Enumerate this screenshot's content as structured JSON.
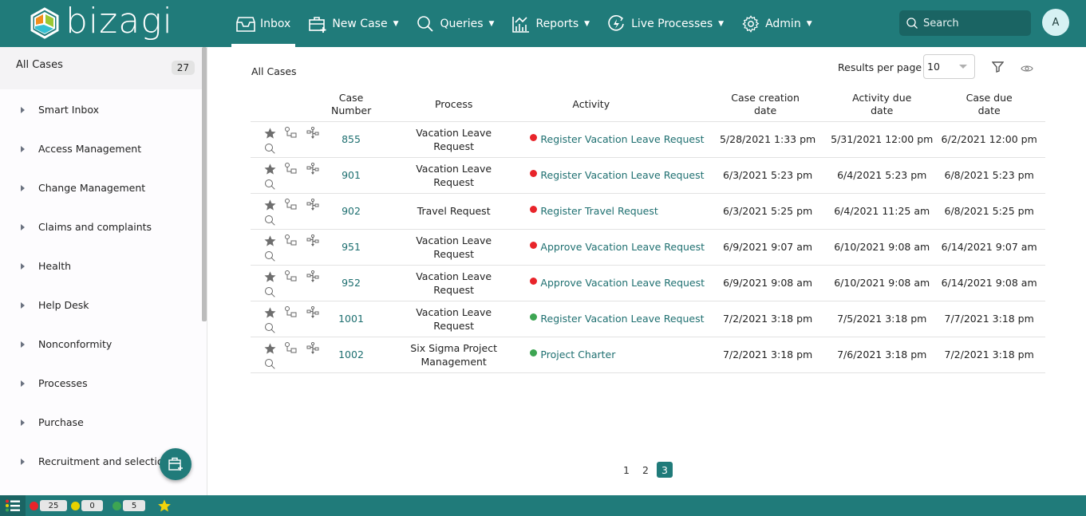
{
  "app": {
    "brand": "bizagi"
  },
  "nav": {
    "items": [
      {
        "label": "Inbox",
        "icon": "inbox-icon",
        "active": true,
        "dropdown": false
      },
      {
        "label": "New Case",
        "icon": "new-case-icon",
        "active": false,
        "dropdown": true
      },
      {
        "label": "Queries",
        "icon": "search-icon",
        "active": false,
        "dropdown": true
      },
      {
        "label": "Reports",
        "icon": "reports-icon",
        "active": false,
        "dropdown": true
      },
      {
        "label": "Live Processes",
        "icon": "live-process-icon",
        "active": false,
        "dropdown": true
      },
      {
        "label": "Admin",
        "icon": "gear-icon",
        "active": false,
        "dropdown": true
      }
    ],
    "search_placeholder": "Search",
    "avatar_initial": "A"
  },
  "sidebar": {
    "all_cases_label": "All Cases",
    "all_cases_count": "27",
    "items": [
      {
        "label": "Smart Inbox"
      },
      {
        "label": "Access Management"
      },
      {
        "label": "Change Management"
      },
      {
        "label": "Claims and complaints"
      },
      {
        "label": "Health"
      },
      {
        "label": "Help Desk"
      },
      {
        "label": "Nonconformity"
      },
      {
        "label": "Processes"
      },
      {
        "label": "Purchase"
      },
      {
        "label": "Recruitment and selection"
      }
    ]
  },
  "main": {
    "title": "All Cases",
    "results_per_page_label": "Results per page",
    "results_per_page_value": "10",
    "columns": [
      "",
      "Case Number",
      "Process",
      "Activity",
      "Case creation date",
      "Activity due date",
      "Case due date"
    ],
    "rows": [
      {
        "case": "855",
        "process": "Vacation Leave Request",
        "status": "red",
        "activity": "Register Vacation Leave Request",
        "created": "5/28/2021 1:33 pm",
        "activity_due": "5/31/2021 12:00 pm",
        "case_due": "6/2/2021 12:00 pm"
      },
      {
        "case": "901",
        "process": "Vacation Leave Request",
        "status": "red",
        "activity": "Register Vacation Leave Request",
        "created": "6/3/2021 5:23 pm",
        "activity_due": "6/4/2021 5:23 pm",
        "case_due": "6/8/2021 5:23 pm"
      },
      {
        "case": "902",
        "process": "Travel Request",
        "status": "red",
        "activity": "Register Travel Request",
        "created": "6/3/2021 5:25 pm",
        "activity_due": "6/4/2021 11:25 am",
        "case_due": "6/8/2021 5:25 pm"
      },
      {
        "case": "951",
        "process": "Vacation Leave Request",
        "status": "red",
        "activity": "Approve Vacation Leave Request",
        "created": "6/9/2021 9:07 am",
        "activity_due": "6/10/2021 9:08 am",
        "case_due": "6/14/2021 9:07 am"
      },
      {
        "case": "952",
        "process": "Vacation Leave Request",
        "status": "red",
        "activity": "Approve Vacation Leave Request",
        "created": "6/9/2021 9:08 am",
        "activity_due": "6/10/2021 9:08 am",
        "case_due": "6/14/2021 9:08 am"
      },
      {
        "case": "1001",
        "process": "Vacation Leave Request",
        "status": "green",
        "activity": "Register Vacation Leave Request",
        "created": "7/2/2021 3:18 pm",
        "activity_due": "7/5/2021 3:18 pm",
        "case_due": "7/7/2021 3:18 pm"
      },
      {
        "case": "1002",
        "process": "Six Sigma Project Management",
        "status": "green",
        "activity": "Project Charter",
        "created": "7/2/2021 3:18 pm",
        "activity_due": "7/6/2021 3:18 pm",
        "case_due": "7/2/2021 3:18 pm"
      }
    ],
    "pagination": {
      "pages": [
        "1",
        "2",
        "3"
      ],
      "current": "3"
    }
  },
  "status_bar": {
    "overdue": "25",
    "at_risk": "0",
    "on_time": "5"
  },
  "colors": {
    "brand": "#207b7a",
    "link": "#1e6f70",
    "status_red": "#e8242a",
    "status_yellow": "#e8d100",
    "status_green": "#3da552",
    "star": "#f2d40a"
  }
}
